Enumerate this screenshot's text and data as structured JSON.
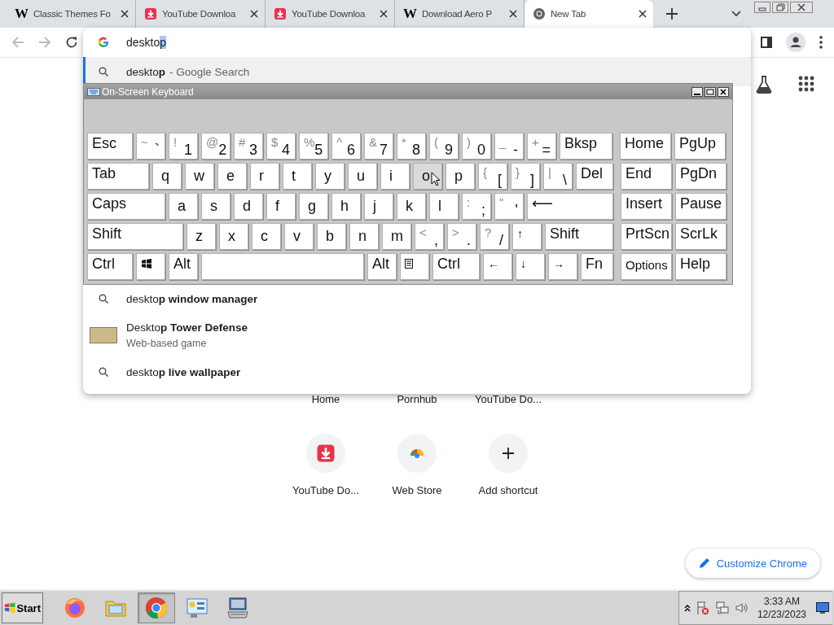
{
  "tabs": [
    {
      "title": "Classic Themes Fo",
      "kind": "letter",
      "favicon_text": "W",
      "selected": false
    },
    {
      "title": "YouTube Downloa",
      "kind": "download",
      "selected": false
    },
    {
      "title": "YouTube Downloa",
      "kind": "download",
      "selected": false
    },
    {
      "title": "Download Aero P",
      "kind": "letter",
      "favicon_text": "W",
      "selected": false
    },
    {
      "title": "New Tab",
      "kind": "chrome",
      "selected": true
    }
  ],
  "omnibox": {
    "typed": "deskto",
    "completion": "p",
    "suggestions": [
      {
        "kind": "search",
        "text": "deskto**p**",
        "suffix": "- Google Search",
        "selected": true
      },
      {
        "kind": "gap"
      },
      {
        "kind": "search",
        "text": "deskto**p window manager**",
        "selected": false
      },
      {
        "kind": "entity",
        "text": "Deskto**p Tower Defense**",
        "subtitle": "Web-based game",
        "selected": false
      },
      {
        "kind": "search",
        "text": "deskto**p live wallpaper**",
        "selected": false
      }
    ]
  },
  "shortcuts": [
    {
      "label": "Home",
      "kind": "none"
    },
    {
      "label": "Pornhub",
      "kind": "none"
    },
    {
      "label": "YouTube Do...",
      "kind": "none"
    },
    {
      "label": "YouTube Do...",
      "kind": "download"
    },
    {
      "label": "Web Store",
      "kind": "webstore"
    },
    {
      "label": "Add shortcut",
      "kind": "add"
    }
  ],
  "customize_button": "Customize Chrome",
  "keyboard": {
    "title": "On-Screen Keyboard",
    "rows": [
      {
        "keys": [
          {
            "kind": "esc",
            "label": "Esc",
            "hovered": false
          },
          {
            "kind": "dual",
            "top": "~",
            "main": "`",
            "hovered": false
          },
          {
            "kind": "dual",
            "top": "!",
            "main": "1",
            "hovered": false
          },
          {
            "kind": "dual",
            "top": "@",
            "main": "2",
            "hovered": false
          },
          {
            "kind": "dual",
            "top": "#",
            "main": "3",
            "hovered": false
          },
          {
            "kind": "dual",
            "top": "$",
            "main": "4",
            "hovered": false
          },
          {
            "kind": "dual",
            "top": "%",
            "main": "5",
            "hovered": false
          },
          {
            "kind": "dual",
            "top": "^",
            "main": "6",
            "hovered": false
          },
          {
            "kind": "dual",
            "top": "&",
            "main": "7",
            "hovered": false
          },
          {
            "kind": "dual",
            "top": "*",
            "main": "8",
            "hovered": false
          },
          {
            "kind": "dual",
            "top": "(",
            "main": "9",
            "hovered": false
          },
          {
            "kind": "dual",
            "top": ")",
            "main": "0",
            "hovered": false
          },
          {
            "kind": "dual",
            "top": "_",
            "main": "-",
            "hovered": false
          },
          {
            "kind": "dual",
            "top": "+",
            "main": "=",
            "hovered": false
          },
          {
            "kind": "bksp",
            "label": "Bksp",
            "hovered": false
          }
        ],
        "nav": [
          {
            "kind": "nav",
            "label": "Home",
            "hovered": false
          },
          {
            "kind": "nav",
            "label": "PgUp",
            "hovered": false
          }
        ]
      },
      {
        "keys": [
          {
            "kind": "tab",
            "label": "Tab",
            "hovered": false
          },
          {
            "kind": "char",
            "label": "q",
            "hovered": false
          },
          {
            "kind": "char",
            "label": "w",
            "hovered": false
          },
          {
            "kind": "char",
            "label": "e",
            "hovered": false
          },
          {
            "kind": "char",
            "label": "r",
            "hovered": false
          },
          {
            "kind": "char",
            "label": "t",
            "hovered": false
          },
          {
            "kind": "char",
            "label": "y",
            "hovered": false
          },
          {
            "kind": "char",
            "label": "u",
            "hovered": false
          },
          {
            "kind": "char",
            "label": "i",
            "hovered": false
          },
          {
            "kind": "char",
            "label": "o",
            "hovered": true
          },
          {
            "kind": "char",
            "label": "p",
            "hovered": false
          },
          {
            "kind": "dual",
            "top": "{",
            "main": "[",
            "hovered": false
          },
          {
            "kind": "dual",
            "top": "}",
            "main": "]",
            "hovered": false
          },
          {
            "kind": "dual",
            "top": "|",
            "main": "\\",
            "hovered": false
          },
          {
            "kind": "del",
            "label": "Del",
            "hovered": false
          }
        ],
        "nav": [
          {
            "kind": "nav",
            "label": "End",
            "hovered": false
          },
          {
            "kind": "nav",
            "label": "PgDn",
            "hovered": false
          }
        ]
      },
      {
        "keys": [
          {
            "kind": "caps",
            "label": "Caps",
            "hovered": false
          },
          {
            "kind": "char",
            "label": "a",
            "hovered": false
          },
          {
            "kind": "char",
            "label": "s",
            "hovered": false
          },
          {
            "kind": "char",
            "label": "d",
            "hovered": false
          },
          {
            "kind": "char",
            "label": "f",
            "hovered": false
          },
          {
            "kind": "char",
            "label": "g",
            "hovered": false
          },
          {
            "kind": "char",
            "label": "h",
            "hovered": false
          },
          {
            "kind": "char",
            "label": "j",
            "hovered": false
          },
          {
            "kind": "char",
            "label": "k",
            "hovered": false
          },
          {
            "kind": "char",
            "label": "l",
            "hovered": false
          },
          {
            "kind": "dual",
            "top": ":",
            "main": ";",
            "hovered": false
          },
          {
            "kind": "dual",
            "top": "\"",
            "main": "'",
            "hovered": false
          },
          {
            "kind": "enter",
            "label": "⟵",
            "hovered": false
          }
        ],
        "nav": [
          {
            "kind": "nav",
            "label": "Insert",
            "hovered": false
          },
          {
            "kind": "nav",
            "label": "Pause",
            "hovered": false
          }
        ]
      },
      {
        "keys": [
          {
            "kind": "lshift",
            "label": "Shift",
            "hovered": false
          },
          {
            "kind": "char",
            "label": "z",
            "hovered": false
          },
          {
            "kind": "char",
            "label": "x",
            "hovered": false
          },
          {
            "kind": "char",
            "label": "c",
            "hovered": false
          },
          {
            "kind": "char",
            "label": "v",
            "hovered": false
          },
          {
            "kind": "char",
            "label": "b",
            "hovered": false
          },
          {
            "kind": "char",
            "label": "n",
            "hovered": false
          },
          {
            "kind": "char",
            "label": "m",
            "hovered": false
          },
          {
            "kind": "dual",
            "top": "<",
            "main": ",",
            "hovered": false
          },
          {
            "kind": "dual",
            "top": ">",
            "main": ".",
            "hovered": false
          },
          {
            "kind": "dual",
            "top": "?",
            "main": "/",
            "hovered": false
          },
          {
            "kind": "arrow",
            "label": "↑",
            "hovered": false
          },
          {
            "kind": "rshift",
            "label": "Shift",
            "hovered": false
          }
        ],
        "nav": [
          {
            "kind": "nav",
            "label": "PrtScn",
            "hovered": false
          },
          {
            "kind": "nav",
            "label": "ScrLk",
            "hovered": false
          }
        ]
      },
      {
        "keys": [
          {
            "kind": "ctrl",
            "label": "Ctrl",
            "hovered": false
          },
          {
            "kind": "win",
            "hovered": false
          },
          {
            "kind": "alt",
            "label": "Alt",
            "hovered": false
          },
          {
            "kind": "space",
            "hovered": false
          },
          {
            "kind": "alt",
            "label": "Alt",
            "hovered": false
          },
          {
            "kind": "menu",
            "hovered": false
          },
          {
            "kind": "rctrl",
            "label": "Ctrl",
            "hovered": false
          },
          {
            "kind": "arrow",
            "label": "←",
            "hovered": false
          },
          {
            "kind": "arrow",
            "label": "↓",
            "hovered": false
          },
          {
            "kind": "arrow",
            "label": "→",
            "hovered": false
          },
          {
            "kind": "fn",
            "label": "Fn",
            "hovered": false
          }
        ],
        "nav": [
          {
            "kind": "navsmall",
            "label": "Options",
            "hovered": false
          },
          {
            "kind": "nav",
            "label": "Help",
            "hovered": false
          }
        ]
      }
    ]
  },
  "taskbar": {
    "start": "Start",
    "apps": [
      {
        "kind": "firefox",
        "selected": false
      },
      {
        "kind": "folder",
        "selected": false
      },
      {
        "kind": "chrome",
        "selected": true
      },
      {
        "kind": "panel",
        "selected": false
      },
      {
        "kind": "keyboard",
        "selected": false
      }
    ],
    "time": "3:33 AM",
    "date": "12/23/2023"
  }
}
